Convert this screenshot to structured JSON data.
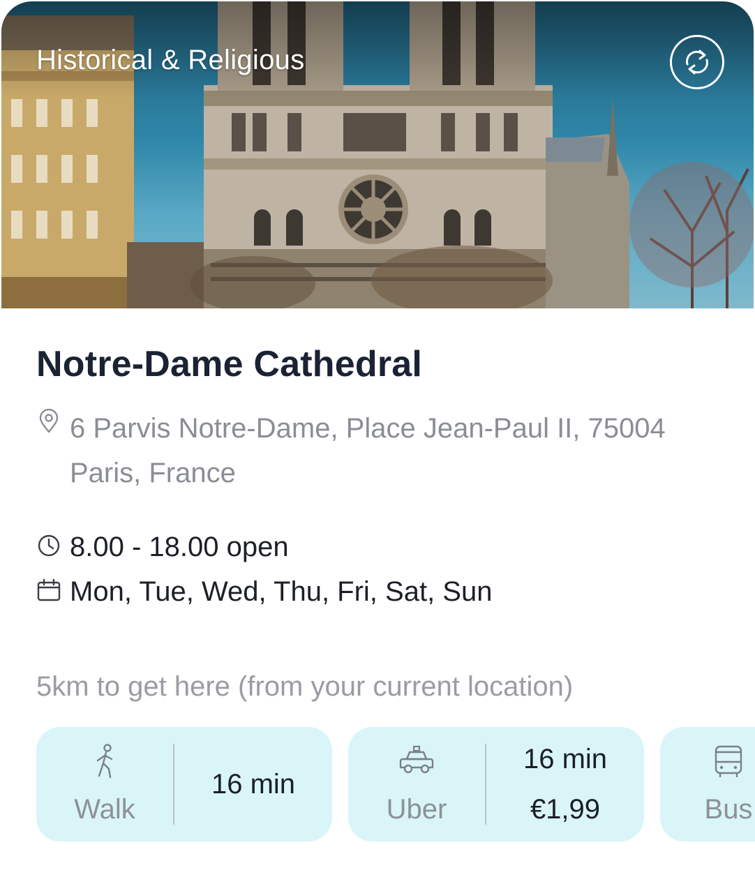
{
  "hero": {
    "category": "Historical & Religious",
    "action_icon": "sync-icon"
  },
  "place": {
    "name": "Notre-Dame Cathedral",
    "address": "6 Parvis Notre-Dame, Place Jean-Paul II, 75004 Paris, France",
    "hours": "8.00 - 18.00 open",
    "days": "Mon, Tue, Wed, Thu, Fri, Sat, Sun"
  },
  "distance_text": "5km to get here (from your current location)",
  "transport": [
    {
      "mode": "Walk",
      "icon": "walking-person-icon",
      "time": "16 min"
    },
    {
      "mode": "Uber",
      "icon": "car-icon",
      "time": "16 min",
      "price": "€1,99"
    },
    {
      "mode": "Bus",
      "icon": "bus-icon"
    }
  ],
  "colors": {
    "card_bg": "#d9f5f8",
    "title": "#1a2233",
    "muted": "#8a8d94"
  }
}
